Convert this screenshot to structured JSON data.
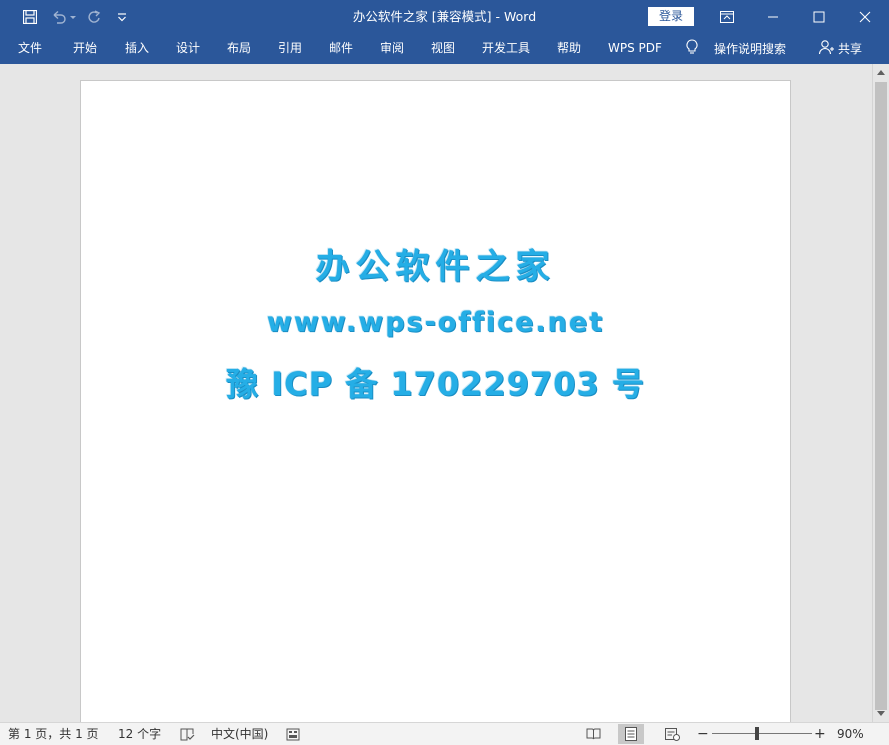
{
  "window": {
    "title": "办公软件之家 [兼容模式]  -  Word",
    "login_label": "登录"
  },
  "ribbon": {
    "tabs": [
      "文件",
      "开始",
      "插入",
      "设计",
      "布局",
      "引用",
      "邮件",
      "审阅",
      "视图",
      "开发工具",
      "帮助",
      "WPS PDF"
    ],
    "tell_me": "操作说明搜索",
    "share": "共享"
  },
  "document": {
    "lines": [
      "办公软件之家",
      "www.wps-office.net",
      "豫 ICP 备 170229703 号"
    ],
    "text_color": "#25aee6"
  },
  "status": {
    "page": "第 1 页，共 1 页",
    "words": "12 个字",
    "language": "中文(中国)",
    "zoom": "90%",
    "zoom_percent": 90
  },
  "colors": {
    "brand": "#2b579a",
    "status_bg": "#f3f3f3"
  },
  "icons": {
    "save": "save-icon",
    "undo": "undo-icon",
    "redo": "redo-icon",
    "customize": "customize-qat-icon",
    "ribbon_display": "ribbon-display-options-icon",
    "minimize": "minimize-icon",
    "maximize": "maximize-icon",
    "close": "close-icon",
    "lightbulb": "lightbulb-icon",
    "share": "share-person-icon"
  }
}
